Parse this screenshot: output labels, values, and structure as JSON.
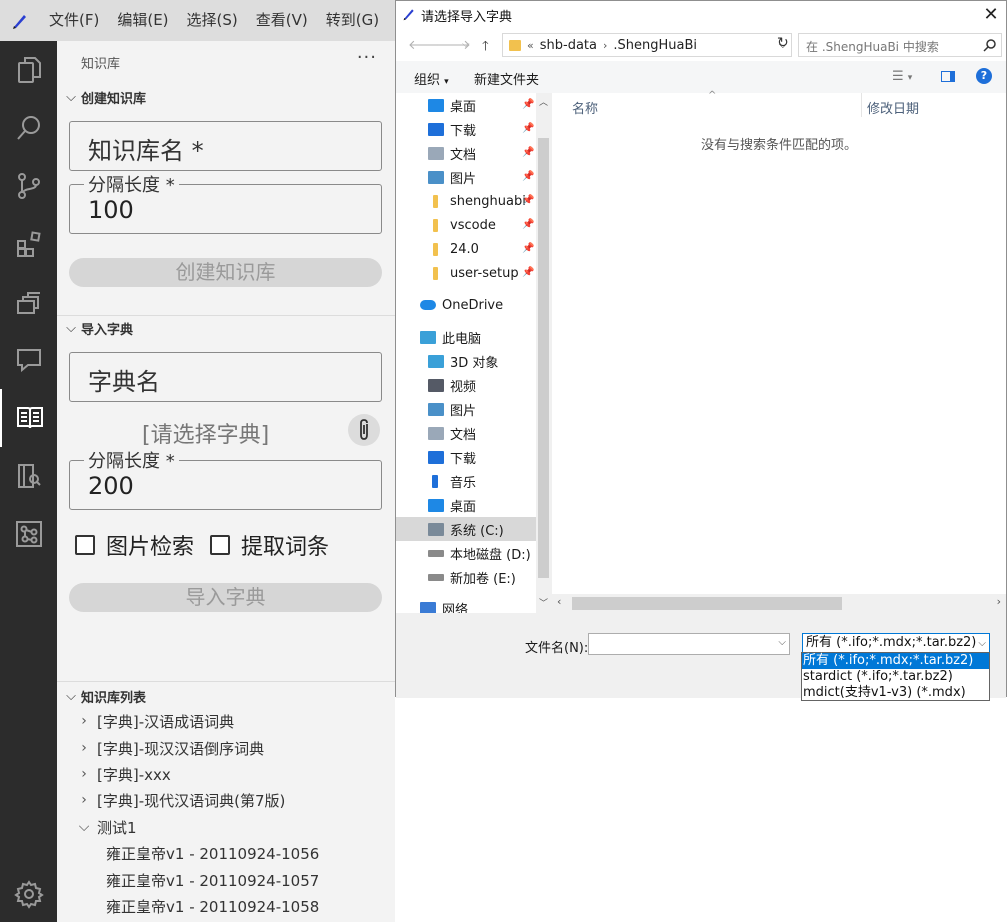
{
  "menubar": {
    "items": [
      "文件(F)",
      "编辑(E)",
      "选择(S)",
      "查看(V)",
      "转到(G)"
    ]
  },
  "activity_icons": [
    "explorer-icon",
    "search-icon",
    "source-control-icon",
    "extensions-icon",
    "remote-icon",
    "comments-icon",
    "knowledge-book-icon",
    "book-search-icon",
    "graph-icon",
    "settings-gear-icon"
  ],
  "sidebar": {
    "title": "知识库",
    "more": "···",
    "create": {
      "heading": "创建知识库",
      "name_placeholder": "知识库名 *",
      "chunk_label": "分隔长度 *",
      "chunk_value": "100",
      "button": "创建知识库"
    },
    "import": {
      "heading": "导入字典",
      "name_placeholder": "字典名",
      "pick_text": "[请选择字典]",
      "chunk_label": "分隔长度 *",
      "chunk_value": "200",
      "checkbox_image": "图片检索",
      "checkbox_terms": "提取词条",
      "button": "导入字典"
    },
    "list": {
      "heading": "知识库列表",
      "items": [
        "[字典]-汉语成语词典",
        "[字典]-现汉汉语倒序词典",
        "[字典]-xxx",
        "[字典]-现代汉语词典(第7版)",
        "测试1"
      ],
      "children": [
        "雍正皇帝v1 - 20110924-1056",
        "雍正皇帝v1 - 20110924-1057",
        "雍正皇帝v1 - 20110924-1058"
      ]
    }
  },
  "dialog": {
    "title": "请选择导入字典",
    "close": "✕",
    "breadcrumb": [
      "shb-data",
      ".ShengHuaBi"
    ],
    "search_placeholder": "在 .ShengHuaBi 中搜索",
    "toolbar": {
      "organize": "组织",
      "new_folder": "新建文件夹"
    },
    "nav_quick": [
      {
        "label": "桌面",
        "color": "#1e88e5"
      },
      {
        "label": "下载",
        "color": "#1e6fd9"
      },
      {
        "label": "文档",
        "color": "#9aa8b8"
      },
      {
        "label": "图片",
        "color": "#4a90c8"
      },
      {
        "label": "shenghuabi",
        "color": "#f2c14e"
      },
      {
        "label": "vscode",
        "color": "#f2c14e"
      },
      {
        "label": "24.0",
        "color": "#f2c14e"
      },
      {
        "label": "user-setup",
        "color": "#f2c14e"
      }
    ],
    "onedrive": "OneDrive",
    "this_pc": "此电脑",
    "nav_pc": [
      {
        "label": "3D 对象",
        "color": "#3aa0d8"
      },
      {
        "label": "视频",
        "color": "#555a66"
      },
      {
        "label": "图片",
        "color": "#4a90c8"
      },
      {
        "label": "文档",
        "color": "#9aa8b8"
      },
      {
        "label": "下载",
        "color": "#1e6fd9"
      },
      {
        "label": "音乐",
        "color": "#1e6fd9"
      },
      {
        "label": "桌面",
        "color": "#1e88e5"
      },
      {
        "label": "系统 (C:)",
        "color": "#7a8a99"
      },
      {
        "label": "本地磁盘 (D:)",
        "color": "#8a8a8a"
      },
      {
        "label": "新加卷 (E:)",
        "color": "#8a8a8a"
      }
    ],
    "network": "网络",
    "columns": {
      "name": "名称",
      "modified": "修改日期"
    },
    "empty_message": "没有与搜索条件匹配的项。",
    "filename_label": "文件名(N):",
    "filename_value": "",
    "filter_selected": "所有 (*.ifo;*.mdx;*.tar.bz2)",
    "filter_options": [
      "所有 (*.ifo;*.mdx;*.tar.bz2)",
      "stardict (*.ifo;*.tar.bz2)",
      "mdict(支持v1-v3) (*.mdx)"
    ]
  },
  "colors": {
    "activity_bg": "#2c2c2c",
    "sidebar_bg": "#f3f3f3",
    "accent": "#0078d7"
  }
}
